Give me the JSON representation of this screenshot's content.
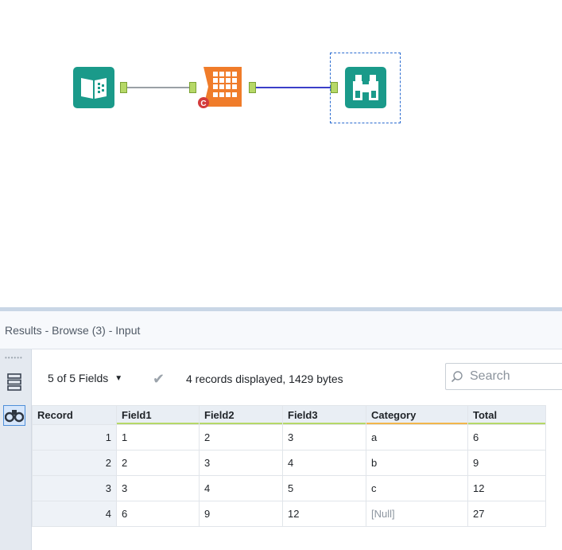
{
  "workflow": {
    "tools": [
      {
        "name": "input-data-tool",
        "icon": "book-icon",
        "color": "#1a9a8a"
      },
      {
        "name": "formula-tool",
        "icon": "formula-grid-icon",
        "color": "#f07c2a",
        "badge": "C"
      },
      {
        "name": "browse-tool",
        "icon": "binoculars-icon",
        "color": "#1a9a8a",
        "selected": true
      }
    ]
  },
  "results": {
    "title": "Results - Browse (3) - Input",
    "fields_selector": "5 of 5 Fields",
    "records_info": "4 records displayed, 1429 bytes",
    "search_placeholder": "Search"
  },
  "table": {
    "record_header": "Record",
    "columns": [
      "Field1",
      "Field2",
      "Field3",
      "Category",
      "Total"
    ],
    "column_type_colors": [
      "#b6d867",
      "#b6d867",
      "#b6d867",
      "#f2b64a",
      "#b6d867"
    ],
    "rows": [
      {
        "record": "1",
        "cells": [
          "1",
          "2",
          "3",
          "a",
          "6"
        ]
      },
      {
        "record": "2",
        "cells": [
          "2",
          "3",
          "4",
          "b",
          "9"
        ]
      },
      {
        "record": "3",
        "cells": [
          "3",
          "4",
          "5",
          "c",
          "12"
        ]
      },
      {
        "record": "4",
        "cells": [
          "6",
          "9",
          "12",
          "[Null]",
          "27"
        ]
      }
    ]
  },
  "colors": {
    "accent_teal": "#1a9a8a",
    "formula_orange": "#f07c2a",
    "connection_gray": "#9aa0a6",
    "connection_blue": "#3b3fc8",
    "selection_blue": "#2a6bd0"
  }
}
